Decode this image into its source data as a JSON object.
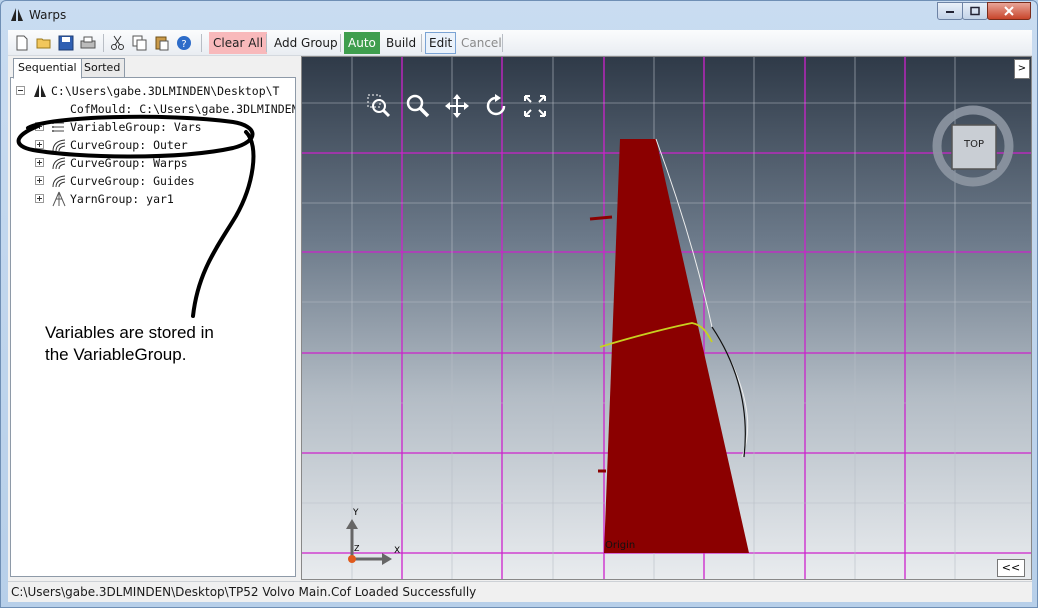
{
  "window": {
    "title": "Warps"
  },
  "toolbar": {
    "icons": [
      "new-file-icon",
      "open-folder-icon",
      "save-icon",
      "print-icon",
      "cut-icon",
      "copy-icon",
      "paste-icon",
      "help-icon"
    ],
    "clear_all": "Clear All",
    "add_group": "Add Group",
    "auto": "Auto",
    "build": "Build",
    "edit": "Edit",
    "cancel": "Cancel"
  },
  "tabs": [
    {
      "label": "Sequential",
      "active": true
    },
    {
      "label": "Sorted",
      "active": false
    }
  ],
  "tree": {
    "root": "C:\\Users\\gabe.3DLMINDEN\\Desktop\\T",
    "items": [
      {
        "label": "CofMould: C:\\Users\\gabe.3DLMINDEN",
        "icon": "mould-icon",
        "expandable": false
      },
      {
        "label": "VariableGroup: Vars",
        "icon": "variable-list-icon",
        "expandable": true
      },
      {
        "label": "CurveGroup: Outer",
        "icon": "curve-group-icon",
        "expandable": true
      },
      {
        "label": "CurveGroup: Warps",
        "icon": "curve-group-icon",
        "expandable": true
      },
      {
        "label": "CurveGroup: Guides",
        "icon": "curve-group-icon",
        "expandable": true
      },
      {
        "label": "YarnGroup: yar1",
        "icon": "yarn-group-icon",
        "expandable": true
      }
    ]
  },
  "annotation": {
    "text_line1": "Variables are stored in",
    "text_line2": "the VariableGroup."
  },
  "viewport": {
    "tools": [
      "zoom-window-icon",
      "zoom-icon",
      "pan-icon",
      "rotate-icon",
      "fit-extents-icon"
    ],
    "view_cube_label": "TOP",
    "axis_x": "X",
    "axis_y": "Y",
    "axis_z": "Z",
    "origin_label": "Origin",
    "expand_label": ">",
    "collapse_label": "<<",
    "colors": {
      "sail": "#8b0000",
      "grid": "#cc22cc",
      "warp": "#c8d020"
    }
  },
  "status": {
    "text": "C:\\Users\\gabe.3DLMINDEN\\Desktop\\TP52 Volvo Main.Cof Loaded Successfully"
  }
}
